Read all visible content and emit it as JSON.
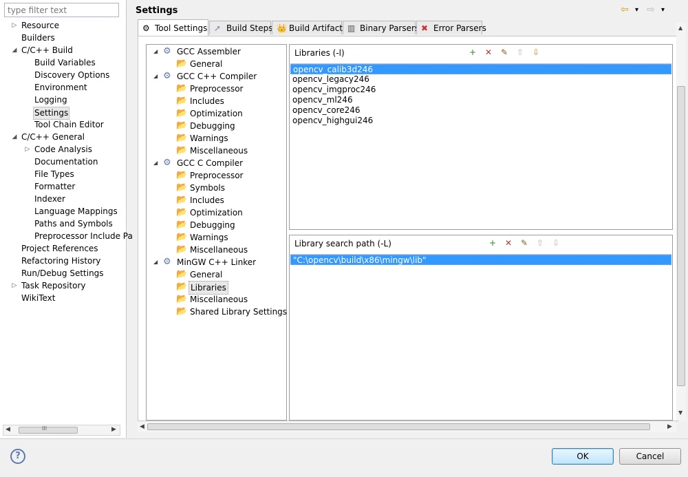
{
  "filter": {
    "placeholder": "type filter text"
  },
  "nav": {
    "items": [
      {
        "label": "Resource",
        "toggle": "▷",
        "level": 0
      },
      {
        "label": "Builders",
        "toggle": "",
        "level": 0
      },
      {
        "label": "C/C++ Build",
        "toggle": "◢",
        "level": 0
      },
      {
        "label": "Build Variables",
        "toggle": "",
        "level": 1
      },
      {
        "label": "Discovery Options",
        "toggle": "",
        "level": 1
      },
      {
        "label": "Environment",
        "toggle": "",
        "level": 1
      },
      {
        "label": "Logging",
        "toggle": "",
        "level": 1
      },
      {
        "label": "Settings",
        "toggle": "",
        "level": 1,
        "selected": true
      },
      {
        "label": "Tool Chain Editor",
        "toggle": "",
        "level": 1
      },
      {
        "label": "C/C++ General",
        "toggle": "◢",
        "level": 0
      },
      {
        "label": "Code Analysis",
        "toggle": "▷",
        "level": 1
      },
      {
        "label": "Documentation",
        "toggle": "",
        "level": 1
      },
      {
        "label": "File Types",
        "toggle": "",
        "level": 1
      },
      {
        "label": "Formatter",
        "toggle": "",
        "level": 1
      },
      {
        "label": "Indexer",
        "toggle": "",
        "level": 1
      },
      {
        "label": "Language Mappings",
        "toggle": "",
        "level": 1
      },
      {
        "label": "Paths and Symbols",
        "toggle": "",
        "level": 1
      },
      {
        "label": "Preprocessor Include Pa",
        "toggle": "",
        "level": 1
      },
      {
        "label": "Project References",
        "toggle": "",
        "level": 0
      },
      {
        "label": "Refactoring History",
        "toggle": "",
        "level": 0
      },
      {
        "label": "Run/Debug Settings",
        "toggle": "",
        "level": 0
      },
      {
        "label": "Task Repository",
        "toggle": "▷",
        "level": 0
      },
      {
        "label": "WikiText",
        "toggle": "",
        "level": 0
      }
    ],
    "scroll_grip": "III"
  },
  "header": {
    "title": "Settings",
    "back_icon": "⇦",
    "forward_icon": "⇨",
    "menu_icon": "▾"
  },
  "tabs": [
    {
      "label": "Tool Settings",
      "icon": "⚙",
      "active": true
    },
    {
      "label": "Build Steps",
      "icon": "➚"
    },
    {
      "label": "Build Artifact",
      "icon": "👑"
    },
    {
      "label": "Binary Parsers",
      "icon": "▥"
    },
    {
      "label": "Error Parsers",
      "icon": "✖"
    }
  ],
  "tool_tree": [
    {
      "label": "GCC Assembler",
      "kind": "tool"
    },
    {
      "label": "General",
      "kind": "leaf"
    },
    {
      "label": "GCC C++ Compiler",
      "kind": "tool"
    },
    {
      "label": "Preprocessor",
      "kind": "leaf"
    },
    {
      "label": "Includes",
      "kind": "leaf"
    },
    {
      "label": "Optimization",
      "kind": "leaf"
    },
    {
      "label": "Debugging",
      "kind": "leaf"
    },
    {
      "label": "Warnings",
      "kind": "leaf"
    },
    {
      "label": "Miscellaneous",
      "kind": "leaf"
    },
    {
      "label": "GCC C Compiler",
      "kind": "tool"
    },
    {
      "label": "Preprocessor",
      "kind": "leaf"
    },
    {
      "label": "Symbols",
      "kind": "leaf"
    },
    {
      "label": "Includes",
      "kind": "leaf"
    },
    {
      "label": "Optimization",
      "kind": "leaf"
    },
    {
      "label": "Debugging",
      "kind": "leaf"
    },
    {
      "label": "Warnings",
      "kind": "leaf"
    },
    {
      "label": "Miscellaneous",
      "kind": "leaf"
    },
    {
      "label": "MinGW C++ Linker",
      "kind": "tool"
    },
    {
      "label": "General",
      "kind": "leaf"
    },
    {
      "label": "Libraries",
      "kind": "leaf",
      "selected": true
    },
    {
      "label": "Miscellaneous",
      "kind": "leaf"
    },
    {
      "label": "Shared Library Settings",
      "kind": "leaf"
    }
  ],
  "libraries": {
    "title": "Libraries (-l)",
    "items": [
      "opencv_calib3d246",
      "opencv_legacy246",
      "opencv_imgproc246",
      "opencv_ml246",
      "opencv_core246",
      "opencv_highgui246"
    ],
    "selected_index": 0
  },
  "search_paths": {
    "title": "Library search path (-L)",
    "items": [
      "\"C:\\opencv\\build\\x86\\mingw\\lib\""
    ],
    "selected_index": 0
  },
  "list_tools": {
    "add": "+",
    "delete": "✕",
    "edit": "✎",
    "up": "⇧",
    "down": "⇩"
  },
  "buttons": {
    "help": "?",
    "ok": "OK",
    "cancel": "Cancel"
  },
  "colors": {
    "selection": "#3399ff",
    "ok_border": "#3c7fb1"
  }
}
